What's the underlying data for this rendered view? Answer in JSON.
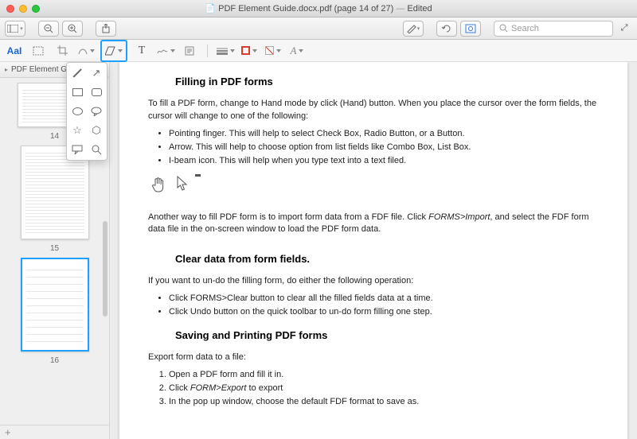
{
  "titlebar": {
    "doc_icon": "📄",
    "filename": "PDF Element Guide.docx.pdf",
    "page_label": "(page 14 of 27)",
    "edited": "Edited"
  },
  "maintoolbar": {
    "search_placeholder": "Search"
  },
  "annotation": {
    "aa": "AaI"
  },
  "sidebar": {
    "title": "PDF Element Guide",
    "pages": [
      {
        "num": "14"
      },
      {
        "num": "15"
      },
      {
        "num": "16"
      }
    ]
  },
  "doc": {
    "h1": "Filling in PDF forms",
    "p1": "To fill a PDF form, change to Hand mode by click (Hand) button. When you place the cursor over the form fields, the cursor will change to one of the following:",
    "b1": "Pointing finger. This will help to select Check Box, Radio Button, or a Button.",
    "b2": "Arrow. This will help to choose option from list fields like Combo Box, List Box.",
    "b3": "I-beam icon. This will help when you type text into a text filed.",
    "p2a": "Another way to fill PDF form is to import form data from a FDF file. Click ",
    "p2b": "FORMS>Import",
    "p2c": ", and select the FDF form data file in the on-screen window to load the PDF form data.",
    "h2": "Clear data from form fields.",
    "p3": "If you want to un-do the filling form, do either the following operation:",
    "b4": "Click FORMS>Clear button to clear all the filled fields data at a time.",
    "b5": "Click Undo button on the quick toolbar to un-do form filling one step.",
    "h3": "Saving and Printing PDF forms",
    "p4": "Export form data to a file:",
    "o1": "Open a PDF form and fill it in.",
    "o2a": "Click ",
    "o2b": "FORM>Export",
    "o2c": " to export",
    "o3": "In the pop up window, choose the default FDF format to save as."
  }
}
